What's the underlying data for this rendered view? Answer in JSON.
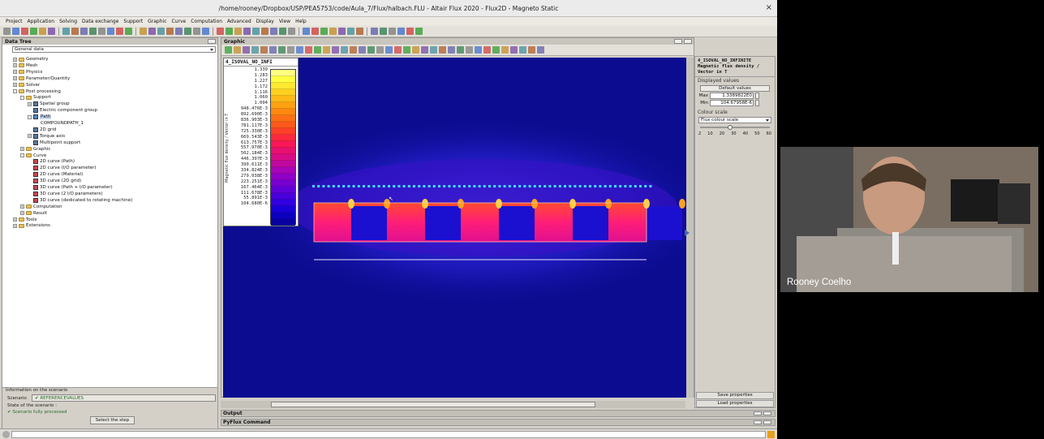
{
  "window": {
    "title": "/home/rooney/Dropbox/USP/PEA5753/code/Aula_7/Flux/halbach.FLU - Altair Flux 2020 - Flux2D - Magneto Static",
    "close": "×"
  },
  "menu": [
    "Project",
    "Application",
    "Solving",
    "Data exchange",
    "Support",
    "Graphic",
    "Curve",
    "Computation",
    "Advanced",
    "Display",
    "View",
    "Help"
  ],
  "data_tree": {
    "title": "Data Tree",
    "selector": "General data",
    "nodes": [
      {
        "label": "Geometry",
        "level": 1,
        "toggle": "+",
        "icon": "folder-icon"
      },
      {
        "label": "Mesh",
        "level": 1,
        "toggle": "+",
        "icon": "folder-icon"
      },
      {
        "label": "Physics",
        "level": 1,
        "toggle": "+",
        "icon": "folder-icon"
      },
      {
        "label": "Parameter/Quantity",
        "level": 1,
        "toggle": "+",
        "icon": "folder-icon"
      },
      {
        "label": "Solver",
        "level": 1,
        "toggle": "+",
        "icon": "folder-icon"
      },
      {
        "label": "Post processing",
        "level": 1,
        "toggle": "-",
        "icon": "folder-icon"
      },
      {
        "label": "Support",
        "level": 2,
        "toggle": "-",
        "icon": "folder-icon"
      },
      {
        "label": "Spatial group",
        "level": 3,
        "toggle": "+",
        "icon": "item-icon"
      },
      {
        "label": "Electric component group",
        "level": 3,
        "toggle": "",
        "icon": "item-icon"
      },
      {
        "label": "Path",
        "level": 3,
        "toggle": "-",
        "icon": "path-icon"
      },
      {
        "label": "COMPOUNDPATH_1",
        "level": 4,
        "toggle": "",
        "icon": ""
      },
      {
        "label": "2D grid",
        "level": 3,
        "toggle": "",
        "icon": "item-icon"
      },
      {
        "label": "Torque axis",
        "level": 3,
        "toggle": "+",
        "icon": "item-icon"
      },
      {
        "label": "Multipoint support",
        "level": 3,
        "toggle": "",
        "icon": "item-icon"
      },
      {
        "label": "Graphic",
        "level": 2,
        "toggle": "+",
        "icon": "folder-icon"
      },
      {
        "label": "Curve",
        "level": 2,
        "toggle": "-",
        "icon": "folder-icon"
      },
      {
        "label": "2D curve (Path)",
        "level": 3,
        "toggle": "",
        "icon": "curve-icon"
      },
      {
        "label": "2D curve (I/O parameter)",
        "level": 3,
        "toggle": "",
        "icon": "curve-icon"
      },
      {
        "label": "2D curve (Material)",
        "level": 3,
        "toggle": "",
        "icon": "curve-icon"
      },
      {
        "label": "3D curve (2D grid)",
        "level": 3,
        "toggle": "",
        "icon": "curve-icon"
      },
      {
        "label": "3D curve (Path + I/O parameter)",
        "level": 3,
        "toggle": "",
        "icon": "curve-icon"
      },
      {
        "label": "3D curve (2 I/O parameters)",
        "level": 3,
        "toggle": "",
        "icon": "curve-icon"
      },
      {
        "label": "3D curve (dedicated to rotating machine)",
        "level": 3,
        "toggle": "",
        "icon": "curve-icon"
      },
      {
        "label": "Computation",
        "level": 2,
        "toggle": "+",
        "icon": "folder-icon"
      },
      {
        "label": "Result",
        "level": 2,
        "toggle": "+",
        "icon": "folder-icon"
      },
      {
        "label": "Tools",
        "level": 1,
        "toggle": "+",
        "icon": "folder-icon"
      },
      {
        "label": "Extensions",
        "level": 1,
        "toggle": "+",
        "icon": "folder-icon"
      }
    ]
  },
  "info": {
    "title": "Information on the scenario",
    "scenario_label": "Scenario",
    "scenario_value": "REFERENCEVALUES",
    "state_label": "State of the scenario :",
    "state_value": "Scenario fully processed",
    "step_button": "Select the step"
  },
  "graphic": {
    "title": "Graphic",
    "legend": {
      "title": "4_ISOVAL_NO_INFI",
      "quantity": "Magnetic flux density / Vector in T",
      "values": [
        "1.339",
        "1.283",
        "1.227",
        "1.172",
        "1.116",
        "1.060",
        "1.004",
        "948.476E-3",
        "892.690E-3",
        "836.903E-3",
        "781.117E-3",
        "725.330E-3",
        "669.543E-3",
        "613.757E-3",
        "557.970E-3",
        "502.184E-3",
        "446.397E-3",
        "390.611E-3",
        "334.824E-3",
        "279.038E-3",
        "223.251E-3",
        "167.464E-3",
        "111.678E-3",
        "55.891E-3",
        "104.680E-6"
      ],
      "colors": [
        "#ffff80",
        "#ffff40",
        "#ffe830",
        "#ffd020",
        "#ffb818",
        "#ffa010",
        "#ff8810",
        "#ff7014",
        "#ff581c",
        "#ff4028",
        "#ff2840",
        "#f81858",
        "#e81070",
        "#d80c88",
        "#c008a0",
        "#a804b8",
        "#9000c8",
        "#7800d0",
        "#6000d8",
        "#4800dc",
        "#3000e0",
        "#1800d8",
        "#0c00c0",
        "#0800a0"
      ]
    }
  },
  "properties": {
    "title_line1": "4_ISOVAL_NO_INFINITE",
    "title_line2": "Magnetic flux density /",
    "title_line3": "Vector in T",
    "displayed_values": "Displayed values",
    "default_values": "Default values",
    "max_label": "Max",
    "max_value": "1.3389822E0",
    "min_label": "Min",
    "min_value": "104.67958E-6",
    "colour_scale": "Colour scale",
    "scale_type": "Flux colour scale",
    "slider_value": 20,
    "ticks": [
      "2",
      "10",
      "20",
      "30",
      "40",
      "50",
      "60"
    ],
    "save": "Save properties",
    "load": "Load properties"
  },
  "panels": {
    "output": "Output",
    "pyflux": "PyFlux Command"
  },
  "webcam": {
    "name": "Rooney Coelho"
  }
}
